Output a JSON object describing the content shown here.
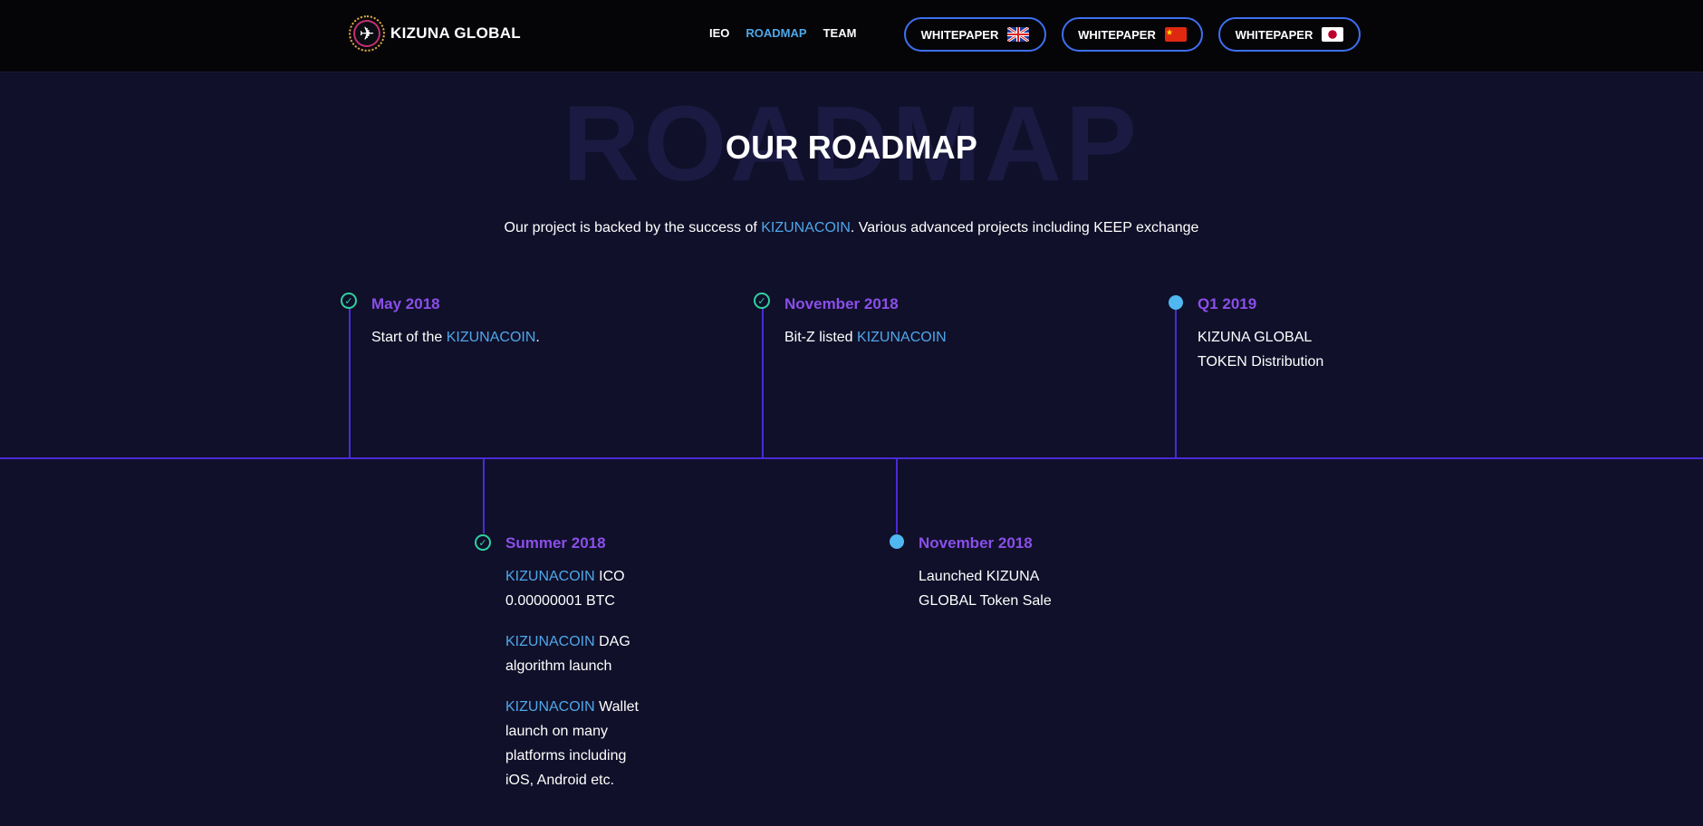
{
  "header": {
    "logo_text": "KIZUNA GLOBAL",
    "nav": [
      {
        "label": "IEO",
        "active": false
      },
      {
        "label": "ROADMAP",
        "active": true
      },
      {
        "label": "TEAM",
        "active": false
      }
    ],
    "whitepapers": [
      {
        "label": "WHITEPAPER",
        "flag": "uk-flag-icon"
      },
      {
        "label": "WHITEPAPER",
        "flag": "china-flag-icon"
      },
      {
        "label": "WHITEPAPER",
        "flag": "japan-flag-icon"
      }
    ]
  },
  "roadmap": {
    "background_word": "ROADMAP",
    "title": "OUR ROADMAP",
    "subtitle_pre": "Our project is backed by the success of ",
    "subtitle_highlight": "KIZUNACOIN",
    "subtitle_post": ". Various advanced projects including KEEP exchange",
    "milestones": [
      {
        "date": "May 2018",
        "status": "done",
        "lines": [
          {
            "pre": "Start of the ",
            "hl": "KIZUNACOIN",
            "post": "."
          }
        ]
      },
      {
        "date": "November 2018",
        "status": "done",
        "lines": [
          {
            "pre": "Bit-Z listed ",
            "hl": "KIZUNACOIN",
            "post": ""
          }
        ]
      },
      {
        "date": "Q1 2019",
        "status": "upcoming",
        "lines": [
          {
            "pre": "KIZUNA GLOBAL TOKEN Distribution",
            "hl": "",
            "post": ""
          }
        ]
      },
      {
        "date": "Summer 2018",
        "status": "done",
        "lines": [
          {
            "pre": "",
            "hl": "KIZUNACOIN",
            "post": " ICO 0.00000001 BTC"
          },
          {
            "pre": "",
            "hl": "KIZUNACOIN",
            "post": " DAG algorithm launch"
          },
          {
            "pre": "",
            "hl": "KIZUNACOIN",
            "post": " Wallet launch on many platforms including iOS, Android etc."
          }
        ]
      },
      {
        "date": "November 2018",
        "status": "upcoming",
        "lines": [
          {
            "pre": "Launched KIZUNA GLOBAL Token Sale",
            "hl": "",
            "post": ""
          }
        ]
      }
    ]
  },
  "colors": {
    "background": "#10102a",
    "accent_blue": "#4fa6e8",
    "date_purple": "#8a4fe8",
    "timeline": "#4a2bd6",
    "check_green": "#2fd1a0"
  }
}
